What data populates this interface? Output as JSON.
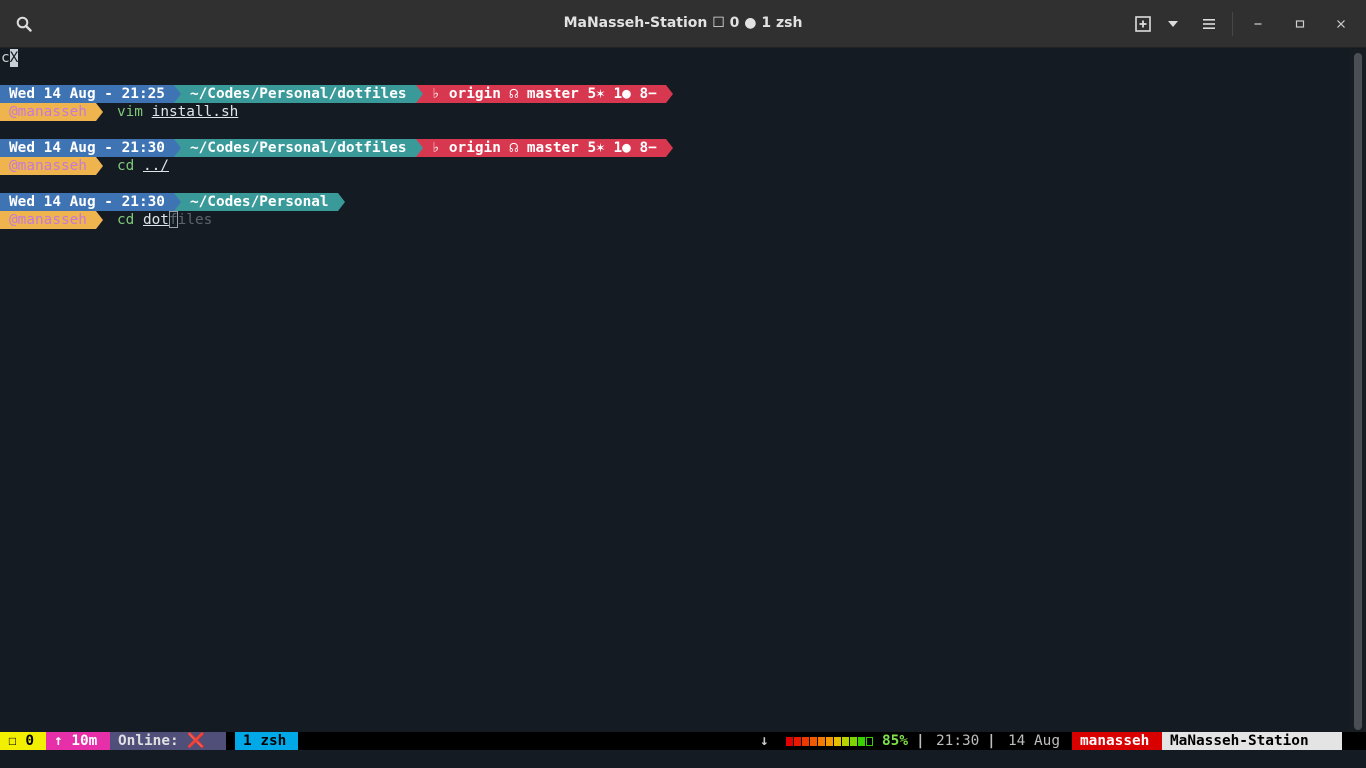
{
  "window": {
    "title": "MaNasseh-Station ☐ 0 ● 1 zsh",
    "icons": [
      "search-icon",
      "new-tab-icon",
      "dropdown-icon",
      "hamburger-menu-icon",
      "minimize-icon",
      "maximize-icon",
      "close-icon"
    ]
  },
  "terminal": {
    "first_line": "c",
    "first_line_selected": "X",
    "prompts": [
      {
        "date": "Wed 14 Aug - 21:25",
        "path": "~/Codes/Personal/dotfiles",
        "git": "♭ origin ☊ master 5✶ 1● 8−",
        "user": "@manasseh",
        "command": "vim",
        "argument": "install.sh",
        "ghost": ""
      },
      {
        "date": "Wed 14 Aug - 21:30",
        "path": "~/Codes/Personal/dotfiles",
        "git": "♭ origin ☊ master 5✶ 1● 8−",
        "user": "@manasseh",
        "command": "cd",
        "argument": "../",
        "ghost": ""
      },
      {
        "date": "Wed 14 Aug - 21:30",
        "path": "~/Codes/Personal",
        "git": "",
        "user": "@manasseh",
        "command": "cd",
        "argument": "dot",
        "ghost": "files"
      }
    ]
  },
  "status_bar": {
    "window_count": "☐ 0",
    "uptime": "↑ 10m",
    "online_label": "Online:",
    "online_status": "❌",
    "active_window": "1 zsh",
    "download_arrow": "↓",
    "battery_percent": "85%",
    "battery_level": 0.85,
    "time": "21:30",
    "separator": "|",
    "date": "14 Aug",
    "user": "manasseh",
    "host": "MaNasseh-Station"
  },
  "colors": {
    "terminal_bg": "#141b22",
    "date_segment": "#3f74b4",
    "path_segment": "#3a9a9a",
    "git_segment": "#d8384f",
    "user_segment": "#f0b44e",
    "status_yellow": "#f2f000",
    "status_magenta": "#e62fa8",
    "status_online": "#4f4f7a",
    "status_active": "#00a8e8",
    "status_user": "#d90000",
    "status_host": "#e4e4e4"
  }
}
